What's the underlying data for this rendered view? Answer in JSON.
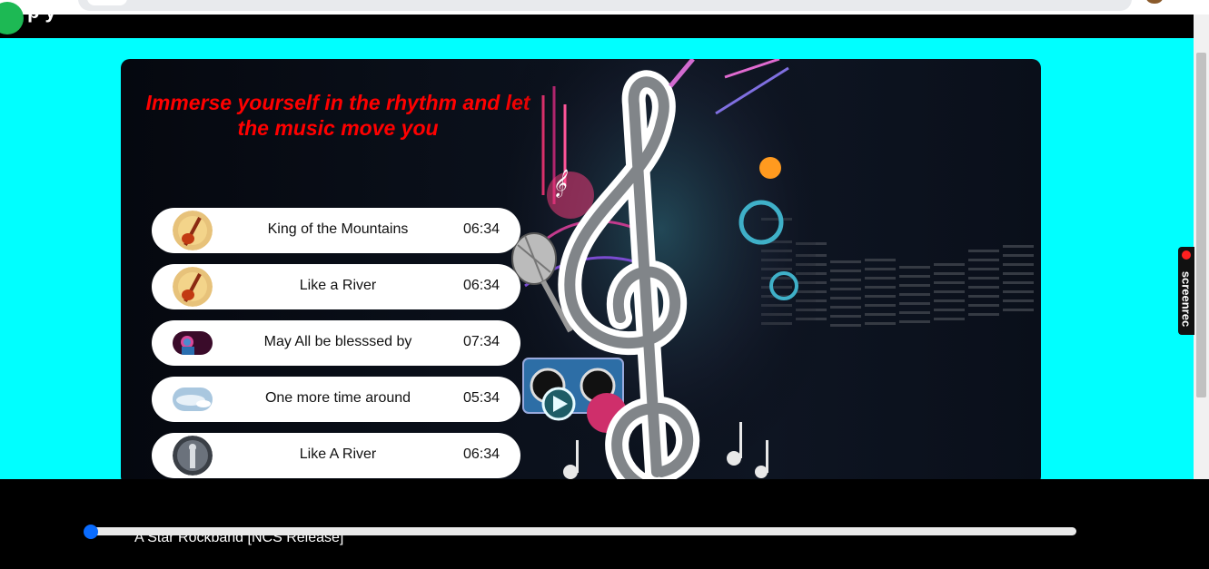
{
  "navbar": {
    "brand_fragment": "p  y"
  },
  "screenrec": {
    "label": "screenrec"
  },
  "hero": {
    "tagline": "Immerse yourself in the rhythm and let the music move you"
  },
  "songs": [
    {
      "title": "King of the Mountains",
      "duration": "06:34",
      "thumb": "guitar-cover"
    },
    {
      "title": "Like a River",
      "duration": "06:34",
      "thumb": "guitar-cover"
    },
    {
      "title": "May All be blesssed by",
      "duration": "07:34",
      "thumb": "neon-portrait"
    },
    {
      "title": "One more time around",
      "duration": "05:34",
      "thumb": "sky-cover"
    },
    {
      "title": "Like A River",
      "duration": "06:34",
      "thumb": "dark-portrait"
    }
  ],
  "player": {
    "now_playing": "A Star Rockband [NCS Release]",
    "progress": 0
  },
  "colors": {
    "background": "#00ffff",
    "tagline": "#ff0000",
    "seek_knob": "#0a6cff"
  }
}
